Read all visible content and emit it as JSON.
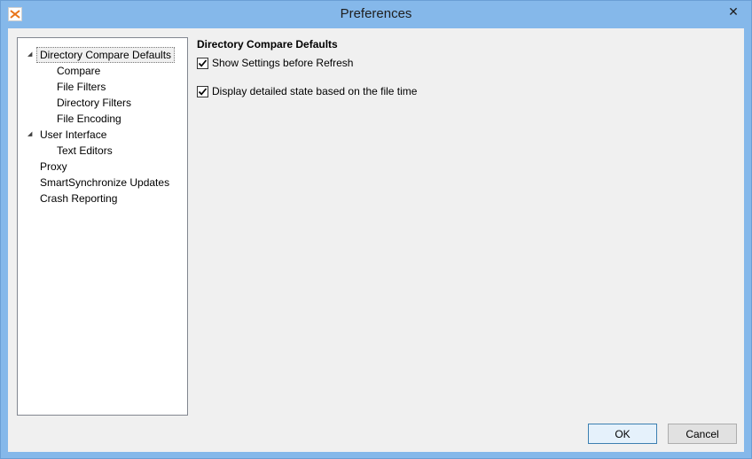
{
  "window": {
    "title": "Preferences",
    "close_glyph": "✕",
    "app_icon": "smartsynchronize-icon"
  },
  "tree": {
    "items": [
      {
        "label": "Directory Compare Defaults",
        "level": 0,
        "expanded": true,
        "selected": true
      },
      {
        "label": "Compare",
        "level": 1
      },
      {
        "label": "File Filters",
        "level": 1
      },
      {
        "label": "Directory Filters",
        "level": 1
      },
      {
        "label": "File Encoding",
        "level": 1
      },
      {
        "label": "User Interface",
        "level": 0,
        "expanded": true
      },
      {
        "label": "Text Editors",
        "level": 1
      },
      {
        "label": "Proxy",
        "level": 0
      },
      {
        "label": "SmartSynchronize Updates",
        "level": 0
      },
      {
        "label": "Crash Reporting",
        "level": 0
      }
    ]
  },
  "content": {
    "section_title": "Directory Compare Defaults",
    "options": [
      {
        "label": "Show Settings before Refresh",
        "checked": true
      },
      {
        "label": "Display detailed state based on the file time",
        "checked": true
      }
    ]
  },
  "buttons": {
    "ok": "OK",
    "cancel": "Cancel"
  }
}
